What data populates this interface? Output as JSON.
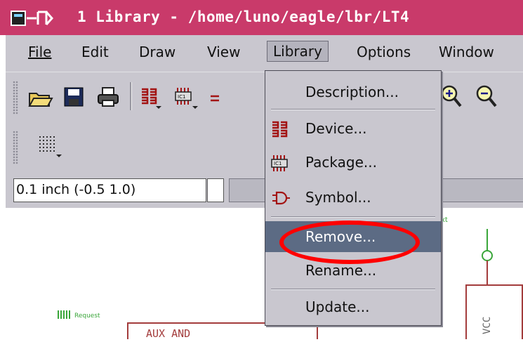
{
  "window": {
    "title": "1 Library - /home/luno/eagle/lbr/LT4"
  },
  "menubar": {
    "items": [
      {
        "label": "File"
      },
      {
        "label": "Edit"
      },
      {
        "label": "Draw"
      },
      {
        "label": "View"
      },
      {
        "label": "Library"
      },
      {
        "label": "Options"
      },
      {
        "label": "Window"
      }
    ]
  },
  "toolbar": {
    "icons": [
      "open-folder-icon",
      "save-icon",
      "print-icon",
      "device-icon",
      "package-icon",
      "zoom-in-icon",
      "zoom-out-icon"
    ],
    "grid_icon": "grid-icon"
  },
  "coordinates": {
    "value": "0.1 inch (-0.5 1.0)"
  },
  "library_menu": {
    "items": [
      {
        "label": "Description...",
        "icon": "",
        "highlighted": false
      },
      {
        "label": "Device...",
        "icon": "device-icon",
        "highlighted": false
      },
      {
        "label": "Package...",
        "icon": "package-icon",
        "highlighted": false
      },
      {
        "label": "Symbol...",
        "icon": "symbol-icon",
        "highlighted": false
      },
      {
        "label": "Remove...",
        "icon": "",
        "highlighted": true
      },
      {
        "label": "Rename...",
        "icon": "",
        "highlighted": false
      },
      {
        "label": "Update...",
        "icon": "",
        "highlighted": false
      }
    ]
  },
  "canvas": {
    "texts": {
      "aux_and": "AUX AND",
      "vcc": "VCC",
      "request": "Request",
      "ext": "xt"
    }
  },
  "colors": {
    "titlebar": "#c93a6a",
    "highlight": "#5c6b84",
    "annotation": "#ff0000",
    "schematic_green": "#3aa63a",
    "schematic_red": "#a33c3c"
  }
}
